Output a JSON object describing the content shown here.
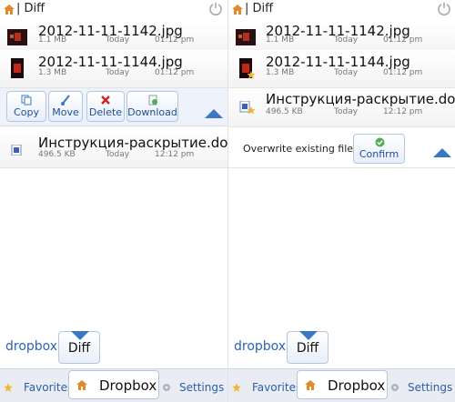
{
  "colors": {
    "accent": "#3b78c4",
    "link": "#2a63b8",
    "delete": "#d32020"
  },
  "left": {
    "title": "| Diff",
    "files": [
      {
        "name": "2012-11-11-1142.jpg",
        "size": "1.1 MB",
        "date": "Today",
        "time": "01:12 pm",
        "icon": "image-thumbnail-icon"
      },
      {
        "name": "2012-11-11-1144.jpg",
        "size": "1.3 MB",
        "date": "Today",
        "time": "01:12 pm",
        "icon": "image-thumbnail-icon"
      },
      {
        "name": "Инструкция-раскрытие.doc",
        "size": "496.5 KB",
        "date": "Today",
        "time": "12:12 pm",
        "icon": "document-icon"
      }
    ],
    "actions": [
      {
        "label": "Copy",
        "icon": "copy-icon"
      },
      {
        "label": "Move",
        "icon": "move-icon"
      },
      {
        "label": "Delete",
        "icon": "delete-icon"
      },
      {
        "label": "Download",
        "icon": "download-icon"
      }
    ],
    "breadcrumb": {
      "root": "dropbox",
      "current": "Diff"
    },
    "tabs": {
      "favorites": "Favorites",
      "dropbox": "Dropbox",
      "settings": "Settings"
    }
  },
  "right": {
    "title": "| Diff",
    "files": [
      {
        "name": "2012-11-11-1142.jpg",
        "size": "1.1 MB",
        "date": "Today",
        "time": "01:12 pm",
        "icon": "image-thumbnail-icon"
      },
      {
        "name": "2012-11-11-1144.jpg",
        "size": "1.3 MB",
        "date": "Today",
        "time": "01:12 pm",
        "icon": "image-thumbnail-favorite-icon"
      },
      {
        "name": "Инструкция-раскрытие.doc",
        "size": "496.5 KB",
        "date": "Today",
        "time": "12:12 pm",
        "icon": "document-favorite-icon"
      }
    ],
    "overwrite": {
      "question": "Overwrite existing file?",
      "confirm": "Confirm"
    },
    "breadcrumb": {
      "root": "dropbox",
      "current": "Diff"
    },
    "tabs": {
      "favorites": "Favorites",
      "dropbox": "Dropbox",
      "settings": "Settings"
    }
  }
}
